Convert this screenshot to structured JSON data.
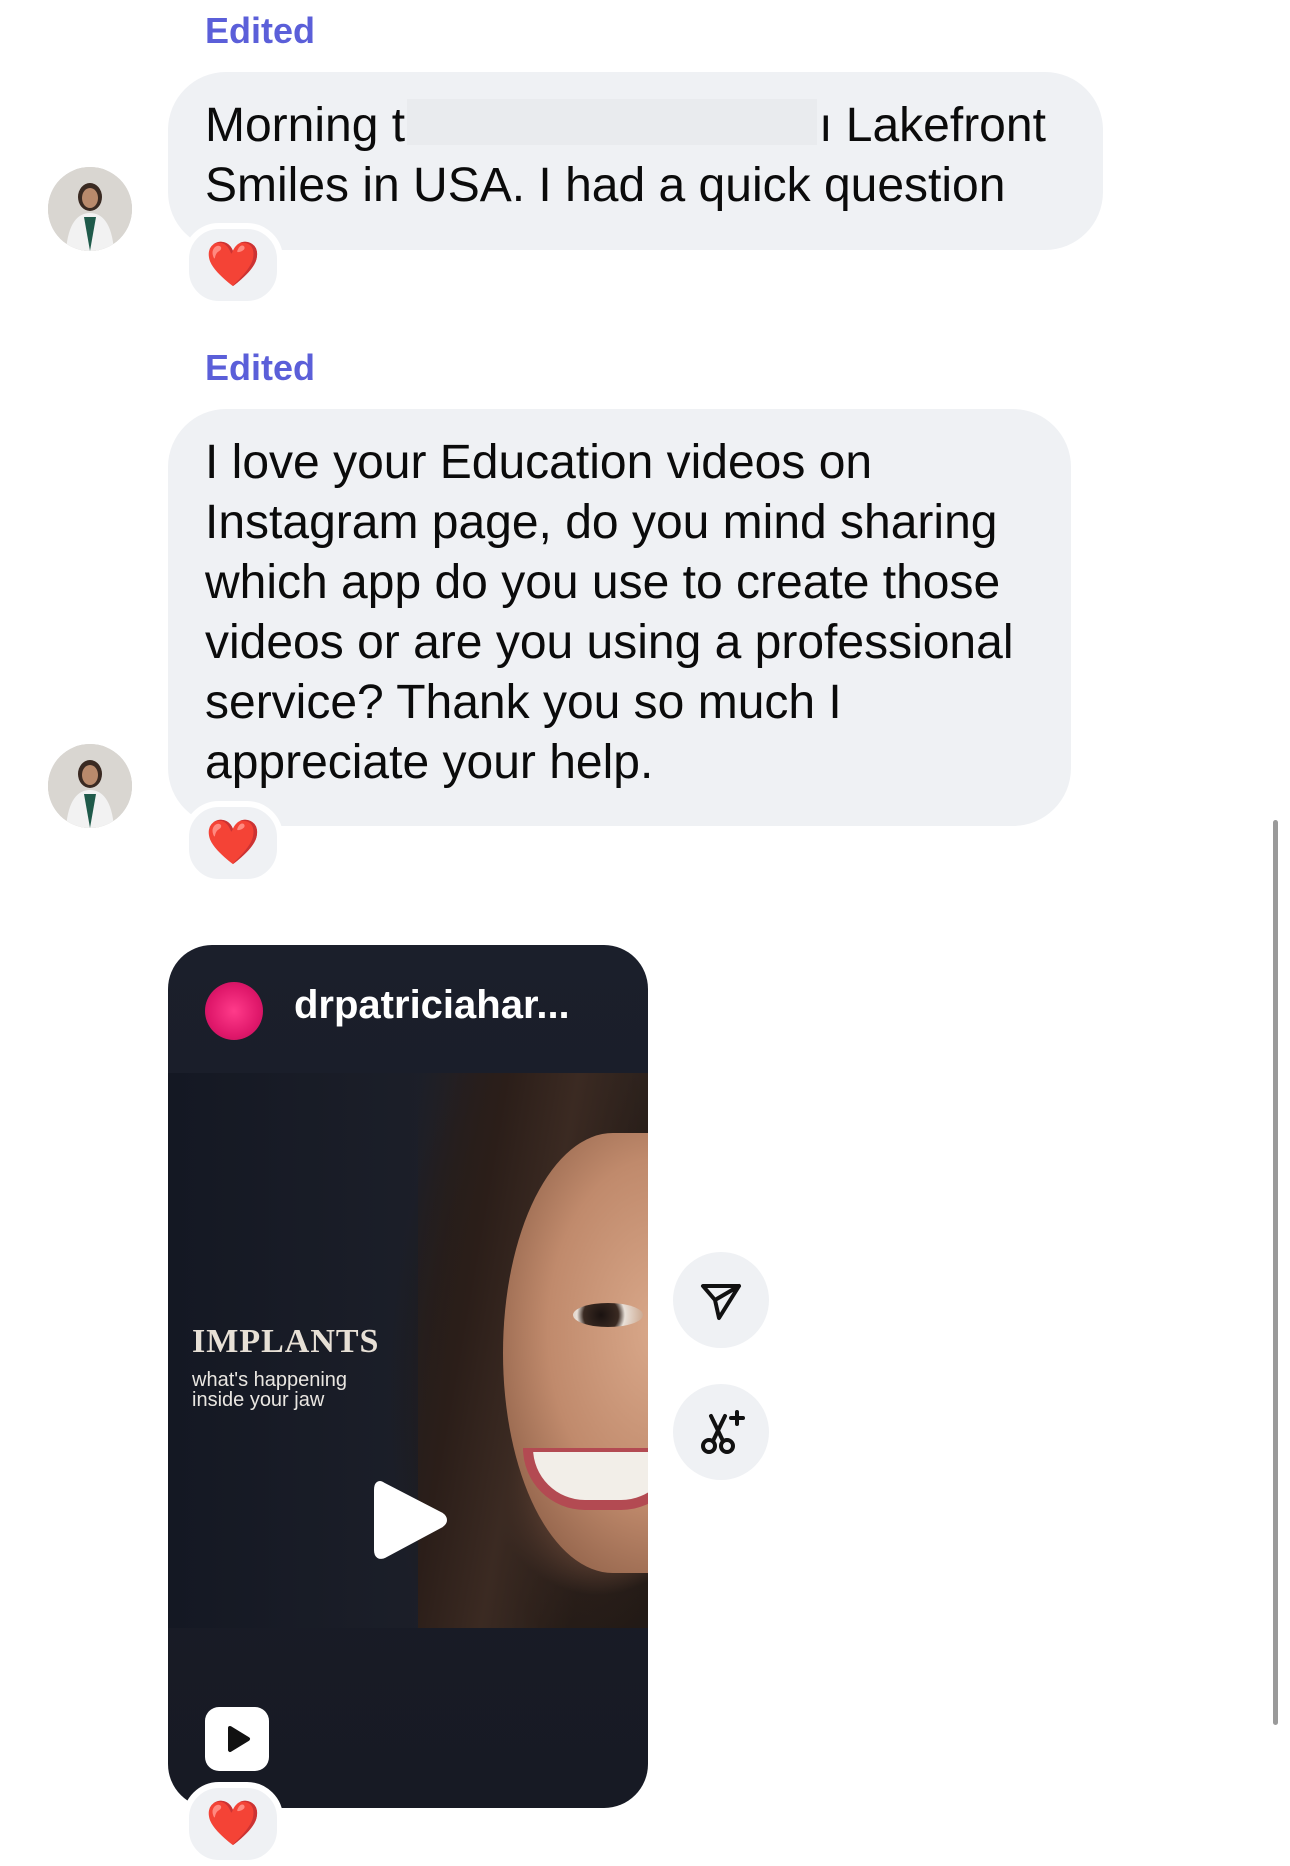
{
  "messages": [
    {
      "edited_label": "Edited",
      "text_before_redaction": "Morning t",
      "text_after_redaction": "ı Lakefront",
      "text_line2": "Smiles in USA. I had a quick question",
      "reaction": "❤️"
    },
    {
      "edited_label": "Edited",
      "text": "I love your Education videos on Instagram page, do you mind sharing which app do you use to create those videos or are you using a professional service? Thank you so much I appreciate your help.",
      "reaction": "❤️"
    }
  ],
  "shared_post": {
    "username": "drpatriciahar...",
    "title": "IMPLANTS",
    "subtitle": "what's happening inside your jaw",
    "reaction": "❤️"
  },
  "icons": {
    "share": "paper-plane-icon",
    "remix": "scissors-sparkle-icon",
    "play": "play-icon",
    "reel": "reel-icon",
    "reaction": "heart-icon"
  },
  "colors": {
    "edited": "#5b5fd9",
    "bubble": "#eff1f4",
    "heart": "#e11b22",
    "card": "#1b1f2b"
  }
}
